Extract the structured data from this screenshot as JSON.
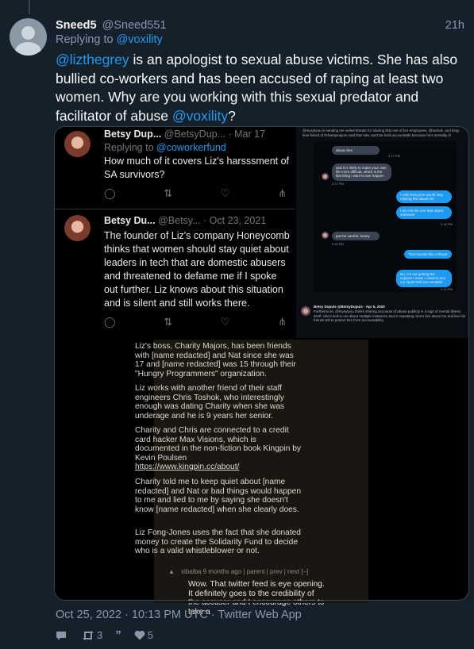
{
  "tweet": {
    "display_name": "Sneed5",
    "handle": "@Sneed551",
    "time_ago": "21h",
    "replying_prefix": "Replying to",
    "replying_to": "@voxility",
    "text_parts": [
      {
        "t": "@lizthegrey",
        "mention": true
      },
      {
        "t": " is an apologist to sexual abuse victims. She has also bullied co-workers and has been accused of raping at least two women. Why are you working with this sexual predator and facilitator of abuse ",
        "mention": false
      },
      {
        "t": "@voxility",
        "mention": true
      },
      {
        "t": "?",
        "mention": false
      }
    ],
    "timestamp": "Oct 25, 2022 · 10:13 PM UTC · Twitter Web App",
    "stats": {
      "retweets": "3",
      "likes": "5"
    }
  },
  "embedded": {
    "tweet1": {
      "name": "Betsy Dup...",
      "handle": "@BetsyDup... · Mar 17",
      "reply_prefix": "Replying to",
      "reply_to": "@coworkerfund",
      "body": "How much of it covers Liz's harsssment of SA survivors?"
    },
    "tweet2": {
      "name": "Betsy Du...",
      "handle": "@Betsy... · Oct 23, 2021",
      "body": "The founder of Liz's company Honeycomb thinks that women should stay quiet about leaders in tech that are domestic abusers and threatened to defame me if I spoke out further. Liz knows about this situation and is silent and still works there."
    },
    "dm": {
      "top_text": "@mysytyou is sending me veiled threats for sharing that one of her employees, @toshok, and long-time friend of #charitymajors said that Alex can't be held accountable because he's mentally ill",
      "msgs": [
        {
          "dir": "in",
          "text": "about Alex"
        },
        {
          "dir": "in",
          "text": "and it is likely to make your own life more difficult, which is the last thing i want to see happen"
        },
        {
          "dir": "out",
          "text": "I wish everyone would stop making this about me"
        },
        {
          "dir": "out",
          "text": "I am not the one that raped someone"
        },
        {
          "dir": "in",
          "text": "just be careful, honey"
        },
        {
          "dir": "out",
          "text": "That sounds like a threat"
        },
        {
          "dir": "out",
          "text": "No, I'm not getting the support i need. I need to see my rapist held accountable"
        }
      ],
      "times": [
        "2:17 PM",
        "2:17 PM",
        "2:18 PM",
        "2:18 PM",
        "2:19 PM"
      ],
      "bottom_name": "Betsy Dupuis @BetsyDupuis · Apr 5, 2020",
      "bottom_text": "Furthermore, @mysytyou thinks sharing accounts of abuse publicly is a sign of mental illness itself. She's lied to me about multiple instances and is repeating Alex's lies about me and lies his friends tell to protect him from accountability."
    },
    "hn": {
      "p1": "Liz's boss, Charity Majors, has been friends with [name redacted] and Nat since she was 17 and [name redacted] was 15 through their \"Hungry Programmers\" organization.",
      "p2": "Liz works with another friend of their staff engineers Chris Toshok, who interestingly enough was dating Charity when she was underage and he is 9 years her senior.",
      "p3": "Charity and Chris are connected to a credit card hacker Max Visions, which is documented in the non-fiction book Kingpin by Kevin Poulsen",
      "p3_link": "https://www.kingpin.cc/about/",
      "p4": "Charity told me to keep quiet about [name redacted] and Nat or bad things would happen to me and lied to me by saying she doesn't know [name redacted] when she clearly does.",
      "p5": "Liz Fong-Jones uses the fact that she donated money to create the Solidarity Fund to decide who is a valid whistleblower or not.",
      "comment_meta": "xibalba 9 months ago | parent | prev | next [–]",
      "comment_text": "Wow. That twitter feed is eye opening. It definitely goes to the credibility of the accuser and I encourage others to take a"
    }
  }
}
